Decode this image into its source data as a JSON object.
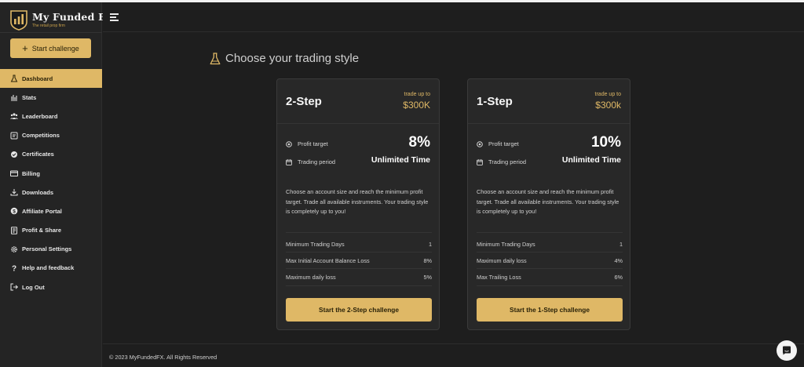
{
  "brand": {
    "name": "My Funded FX",
    "tagline": "The retail prop firm",
    "accent": "#dfb866"
  },
  "sidebar": {
    "start_label": "Start challenge",
    "items": [
      {
        "label": "Dashboard",
        "icon": "flask-icon",
        "active": true
      },
      {
        "label": "Stats",
        "icon": "bar-chart-icon",
        "active": false
      },
      {
        "label": "Leaderboard",
        "icon": "users-icon",
        "active": false
      },
      {
        "label": "Competitions",
        "icon": "trophy-icon",
        "active": false
      },
      {
        "label": "Certificates",
        "icon": "badge-icon",
        "active": false
      },
      {
        "label": "Billing",
        "icon": "credit-card-icon",
        "active": false
      },
      {
        "label": "Downloads",
        "icon": "download-icon",
        "active": false
      },
      {
        "label": "Affiliate Portal",
        "icon": "dollar-icon",
        "active": false
      },
      {
        "label": "Profit & Share",
        "icon": "receipt-icon",
        "active": false
      },
      {
        "label": "Personal Settings",
        "icon": "gear-icon",
        "active": false
      },
      {
        "label": "Help and feedback",
        "icon": "question-icon",
        "active": false
      },
      {
        "label": "Log Out",
        "icon": "logout-icon",
        "active": false
      }
    ]
  },
  "main": {
    "title": "Choose your trading style",
    "cards": [
      {
        "name": "2-Step",
        "trade_up_label": "trade up to",
        "trade_up_amount": "$300K",
        "profit_target_label": "Profit target",
        "profit_target_value": "8%",
        "trading_period_label": "Trading period",
        "trading_period_value": "Unlimited Time",
        "description": "Choose an account size and reach the minimum profit target. Trade all available instruments. Your trading style is completely up to you!",
        "rules": [
          {
            "label": "Minimum Trading Days",
            "value": "1"
          },
          {
            "label": "Max Initial Account Balance Loss",
            "value": "8%"
          },
          {
            "label": "Maximum daily loss",
            "value": "5%"
          }
        ],
        "cta_label": "Start the 2-Step challenge"
      },
      {
        "name": "1-Step",
        "trade_up_label": "trade up to",
        "trade_up_amount": "$300k",
        "profit_target_label": "Profit target",
        "profit_target_value": "10%",
        "trading_period_label": "Trading period",
        "trading_period_value": "Unlimited Time",
        "description": "Choose an account size and reach the minimum profit target. Trade all available instruments. Your trading style is completely up to you!",
        "rules": [
          {
            "label": "Minimum Trading Days",
            "value": "1"
          },
          {
            "label": "Maximum daily loss",
            "value": "4%"
          },
          {
            "label": "Max Trailing Loss",
            "value": "6%"
          }
        ],
        "cta_label": "Start the 1-Step challenge"
      }
    ]
  },
  "footer": {
    "copyright": "© 2023 MyFundedFX. All Rights Reserved"
  }
}
